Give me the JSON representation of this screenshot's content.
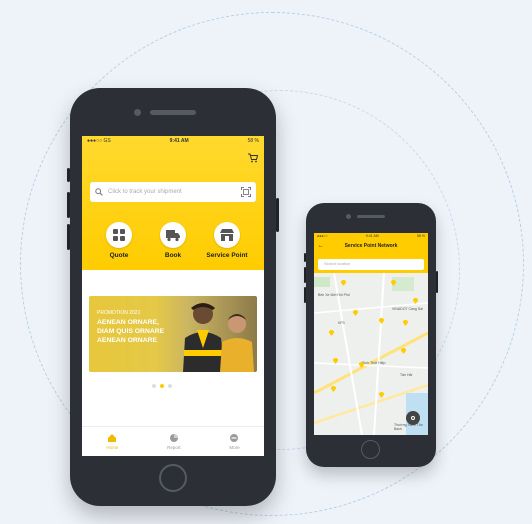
{
  "colors": {
    "brand_yellow": "#ffcc00",
    "phone_body": "#2c2f36",
    "background": "#eef3fa"
  },
  "main_phone": {
    "status": {
      "carrier": "●●●○○ GS",
      "time": "9:41 AM",
      "battery": "58 %"
    },
    "cart_icon": "cart-icon",
    "search": {
      "placeholder": "Click to track your shipment",
      "scan_icon": "barcode-scan-icon"
    },
    "services": [
      {
        "label": "Quote",
        "icon": "grid-icon"
      },
      {
        "label": "Book",
        "icon": "truck-icon"
      },
      {
        "label": "Service Point",
        "icon": "shop-icon"
      }
    ],
    "promo": {
      "tag": "PROMOTION 2021",
      "lines": [
        "AENEAN ORNARE,",
        "DIAM QUIS ORNARE",
        "AENEAN ORNARE"
      ]
    },
    "carousel": {
      "count": 3,
      "active": 2
    },
    "tabs": [
      {
        "label": "Home",
        "icon": "home-icon",
        "active": true
      },
      {
        "label": "Report",
        "icon": "pie-chart-icon",
        "active": false
      },
      {
        "label": "More",
        "icon": "more-icon",
        "active": false
      }
    ]
  },
  "small_phone": {
    "status": {
      "carrier": "●●●○○",
      "time": "9:41 AM",
      "battery": "58 %"
    },
    "title": "Service Point Network",
    "search_placeholder": "Search location",
    "map_labels": [
      "Bến Xe Mới Hội Phố",
      "KP3",
      "VINADOT Cảng Sài",
      "Bình Thới Hiệp",
      "Tân Hải",
      "Thường Xanh Tân Bạch"
    ]
  }
}
